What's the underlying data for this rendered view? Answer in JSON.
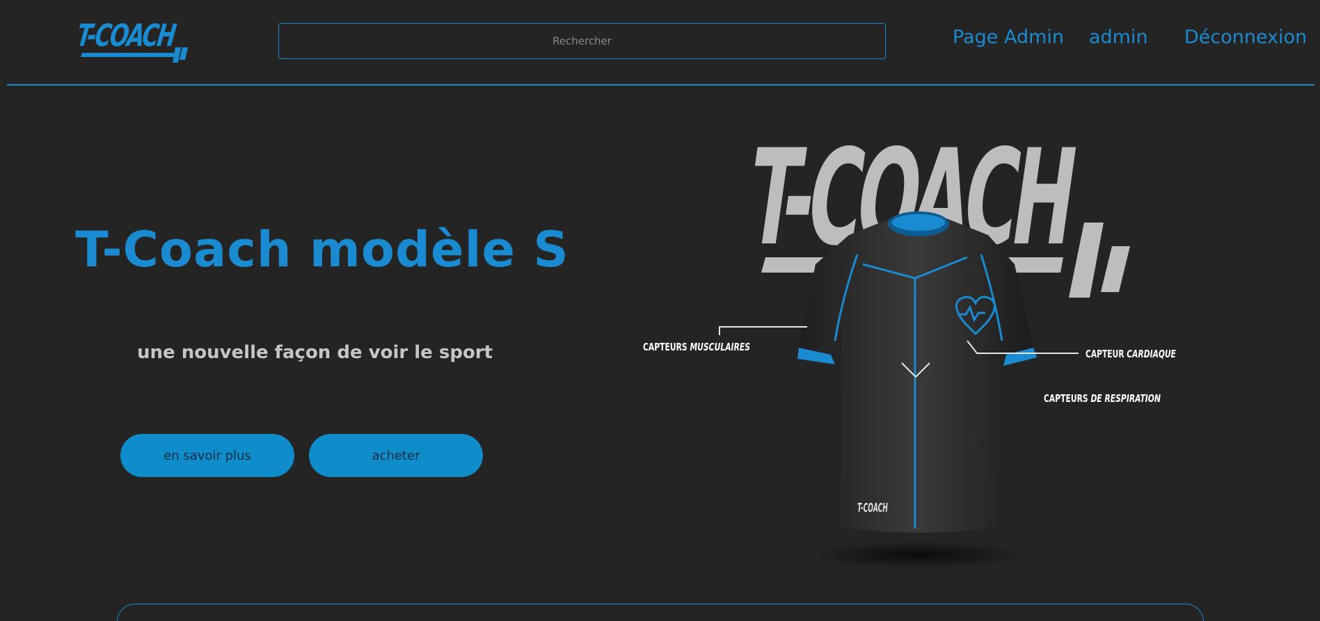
{
  "header": {
    "logo_text": "T-COACH",
    "search": {
      "placeholder": "Rechercher",
      "value": ""
    },
    "nav": [
      {
        "label": "Page Admin"
      },
      {
        "label": "admin"
      },
      {
        "label": "Déconnexion"
      }
    ]
  },
  "hero": {
    "title": "T-Coach modèle S",
    "subtitle": "une nouvelle façon de voir le sport",
    "buttons": [
      {
        "label": "en savoir plus"
      },
      {
        "label": "acheter"
      }
    ],
    "product_image": {
      "brand_text": "T-COACH",
      "labels": {
        "muscular_prefix": "CAPTEURS",
        "muscular_emph": "MUSCULAIRES",
        "cardiac_prefix": "CAPTEUR",
        "cardiac_emph": "CARDIAQUE",
        "breathing_prefix": "CAPTEURS",
        "breathing_emph": "DE RESPIRATION"
      }
    }
  },
  "colors": {
    "background": "#242424",
    "accent": "#1a8bd0",
    "button": "#0f8cca",
    "muted_text": "#c6c6c6"
  },
  "icons": [
    "t-coach-logo",
    "heart-pulse-icon"
  ]
}
